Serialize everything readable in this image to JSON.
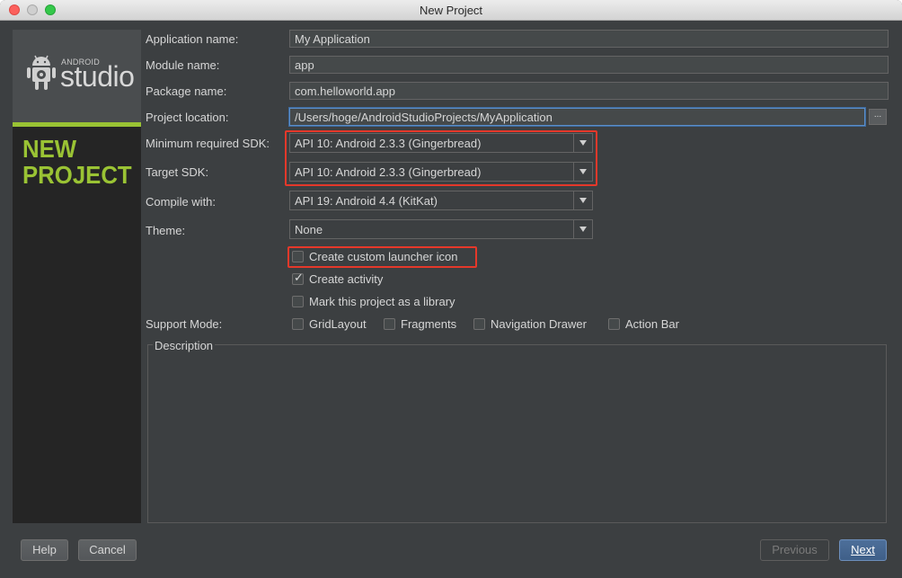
{
  "window": {
    "title": "New Project"
  },
  "sidebar": {
    "brand_small": "ANDROID",
    "brand_large": "studio",
    "title_line1": "NEW",
    "title_line2": "PROJECT"
  },
  "form": {
    "app_name": {
      "label": "Application name:",
      "value": "My Application"
    },
    "module_name": {
      "label": "Module name:",
      "value": "app"
    },
    "package_name": {
      "label": "Package name:",
      "value": "com.helloworld.app"
    },
    "project_location": {
      "label": "Project location:",
      "value": "/Users/hoge/AndroidStudioProjects/MyApplication",
      "browse_label": "..."
    },
    "min_sdk": {
      "label": "Minimum required SDK:",
      "value": "API 10: Android 2.3.3 (Gingerbread)"
    },
    "target_sdk": {
      "label": "Target SDK:",
      "value": "API 10: Android 2.3.3 (Gingerbread)"
    },
    "compile_with": {
      "label": "Compile with:",
      "value": "API 19: Android 4.4 (KitKat)"
    },
    "theme": {
      "label": "Theme:",
      "value": "None"
    }
  },
  "options": {
    "custom_launcher_icon": {
      "label": "Create custom launcher icon",
      "checked": false
    },
    "create_activity": {
      "label": "Create activity",
      "checked": true
    },
    "mark_library": {
      "label": "Mark this project as a library",
      "checked": false
    }
  },
  "support_mode": {
    "label": "Support Mode:",
    "grid_layout": {
      "label": "GridLayout",
      "checked": false
    },
    "fragments": {
      "label": "Fragments",
      "checked": false
    },
    "navigation_drawer": {
      "label": "Navigation Drawer",
      "checked": false
    },
    "action_bar": {
      "label": "Action Bar",
      "checked": false
    }
  },
  "description": {
    "legend": "Description"
  },
  "buttons": {
    "help": "Help",
    "cancel": "Cancel",
    "previous": "Previous",
    "next": "Next"
  },
  "colors": {
    "accent_green": "#9ac334",
    "highlight_red": "#e5382a",
    "background": "#3c3f41",
    "default_button": "#4d6f9a"
  }
}
